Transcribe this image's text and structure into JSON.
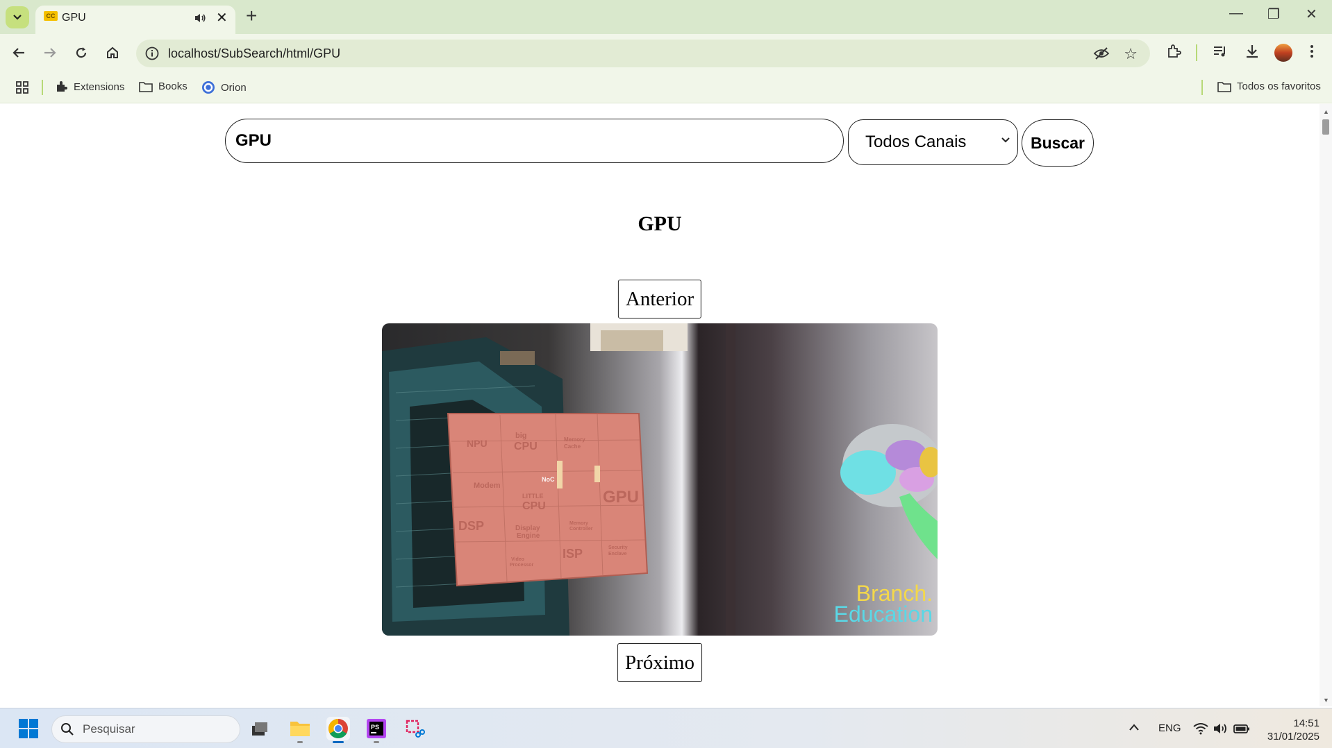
{
  "browser": {
    "tab_title": "GPU",
    "favicon_text": "CC",
    "url": "localhost/SubSearch/html/GPU",
    "bookmarks": [
      {
        "label": "Extensions",
        "icon": "puzzle-icon"
      },
      {
        "label": "Books",
        "icon": "folder-icon"
      },
      {
        "label": "Orion",
        "icon": "orion-icon"
      }
    ],
    "all_bookmarks_label": "Todos os favoritos"
  },
  "search": {
    "query": "GPU",
    "channel_selected": "Todos Canais",
    "submit_label": "Buscar"
  },
  "result": {
    "title": "GPU",
    "prev_label": "Anterior",
    "next_label": "Próximo",
    "video_watermark_line1": "Branch.",
    "video_watermark_line2": "Education",
    "chip_labels": [
      "NPU",
      "big",
      "CPU",
      "Memory",
      "Cache",
      "NoC",
      "Modem",
      "LITTLE",
      "CPU",
      "GPU",
      "DSP",
      "Display",
      "Engine",
      "ISP",
      "Security",
      "Enclave",
      "Video",
      "Processor",
      "Memory",
      "Controller"
    ]
  },
  "taskbar": {
    "search_placeholder": "Pesquisar",
    "language": "ENG",
    "time": "14:51",
    "date": "31/01/2025"
  },
  "colors": {
    "tabbar_bg": "#d9e8cc",
    "toolbar_bg": "#f1f6e9",
    "accent_green": "#b7d977",
    "watermark_yellow": "#f4d84a",
    "watermark_cyan": "#5ad8e6"
  }
}
